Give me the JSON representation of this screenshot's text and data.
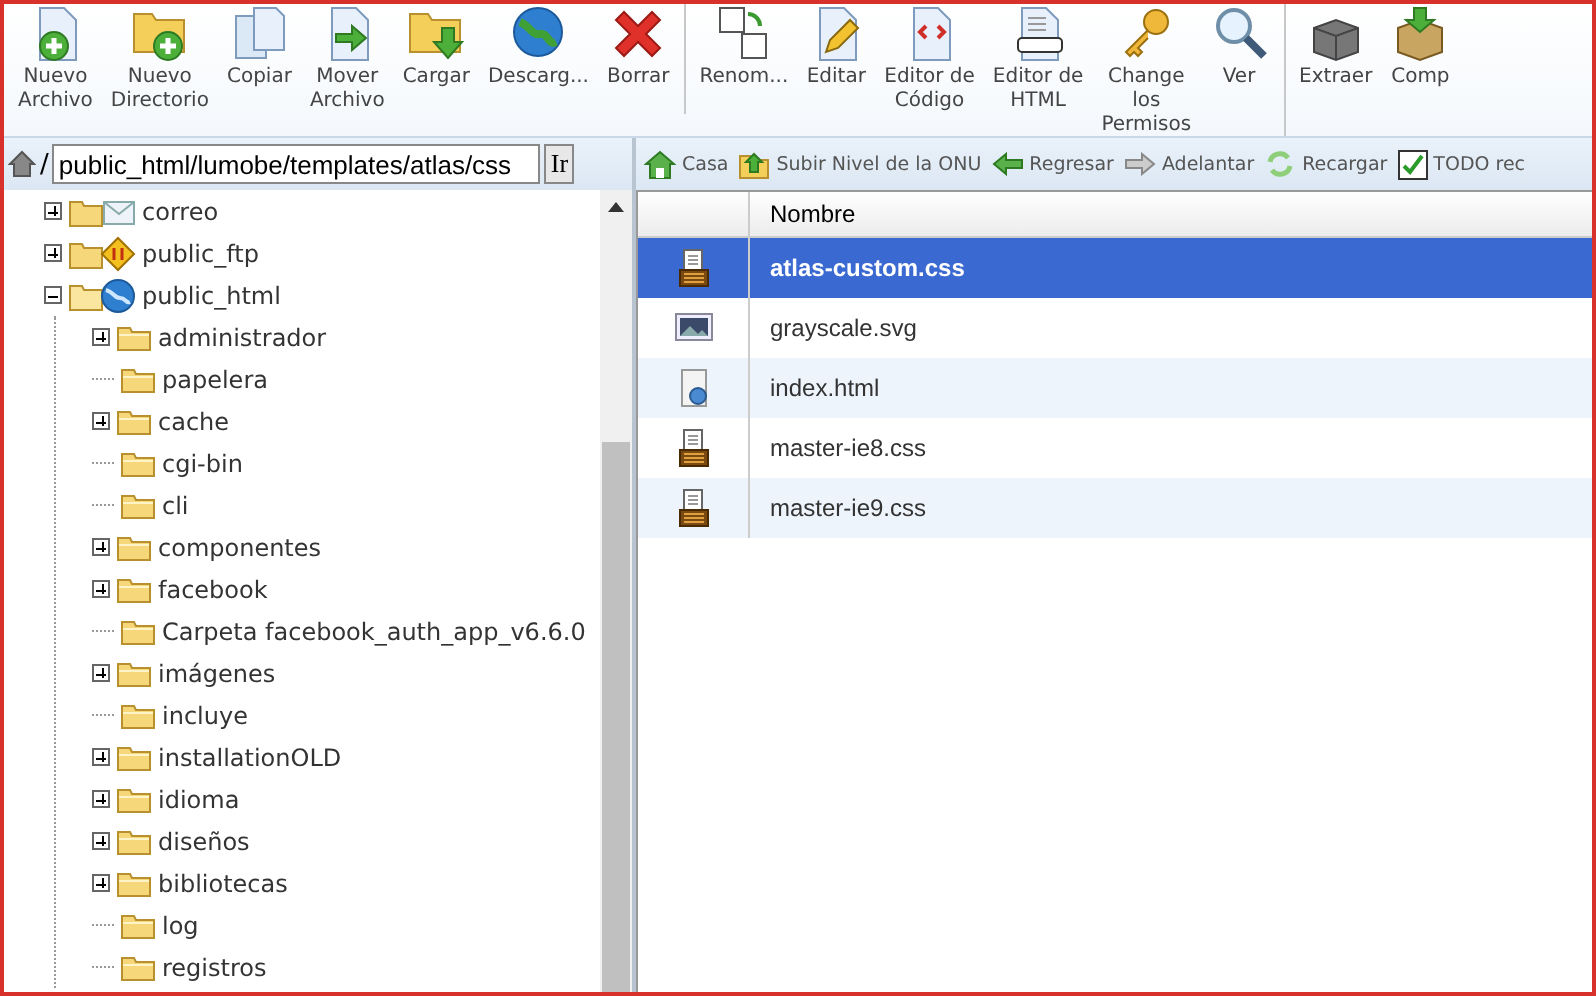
{
  "toolbar": {
    "groups": [
      {
        "buttons": [
          {
            "kind": "new-file",
            "label": "Nuevo\nArchivo"
          },
          {
            "kind": "new-folder",
            "label": "Nuevo\nDirectorio"
          },
          {
            "kind": "copy",
            "label": "Copiar"
          },
          {
            "kind": "move",
            "label": "Mover\nArchivo"
          },
          {
            "kind": "upload",
            "label": "Cargar"
          },
          {
            "kind": "download",
            "label": "Descarg..."
          },
          {
            "kind": "delete",
            "label": "Borrar"
          }
        ]
      },
      {
        "buttons": [
          {
            "kind": "rename",
            "label": "Renom..."
          },
          {
            "kind": "edit",
            "label": "Editar"
          },
          {
            "kind": "code",
            "label": "Editor de\nCódigo"
          },
          {
            "kind": "html",
            "label": "Editor de\nHTML"
          },
          {
            "kind": "key",
            "label": "Change\nlos\nPermisos"
          },
          {
            "kind": "view",
            "label": "Ver"
          }
        ]
      },
      {
        "buttons": [
          {
            "kind": "extract",
            "label": "Extraer"
          },
          {
            "kind": "compress",
            "label": "Comp"
          }
        ]
      }
    ]
  },
  "path_bar": {
    "separator": "/",
    "value": "public_html/lumobe/templates/atlas/css",
    "go_button": "Ir"
  },
  "tree": [
    {
      "label": "correo",
      "kind": "mail",
      "has_children": true,
      "expanded": false
    },
    {
      "label": "public_ftp",
      "kind": "ftp",
      "has_children": true,
      "expanded": false
    },
    {
      "label": "public_html",
      "kind": "web",
      "has_children": true,
      "expanded": true,
      "children": [
        {
          "label": "administrador",
          "kind": "folder",
          "has_children": true,
          "expanded": false
        },
        {
          "label": "papelera",
          "kind": "folder",
          "has_children": false,
          "expanded": false
        },
        {
          "label": "cache",
          "kind": "folder",
          "has_children": true,
          "expanded": false
        },
        {
          "label": "cgi-bin",
          "kind": "folder",
          "has_children": false,
          "expanded": false
        },
        {
          "label": "cli",
          "kind": "folder",
          "has_children": false,
          "expanded": false
        },
        {
          "label": "componentes",
          "kind": "folder",
          "has_children": true,
          "expanded": false
        },
        {
          "label": "facebook",
          "kind": "folder",
          "has_children": true,
          "expanded": false
        },
        {
          "label": "Carpeta facebook_auth_app_v6.6.0",
          "kind": "folder",
          "has_children": false,
          "expanded": false
        },
        {
          "label": "imágenes",
          "kind": "folder",
          "has_children": true,
          "expanded": false
        },
        {
          "label": "incluye",
          "kind": "folder",
          "has_children": false,
          "expanded": false
        },
        {
          "label": "installationOLD",
          "kind": "folder",
          "has_children": true,
          "expanded": false
        },
        {
          "label": "idioma",
          "kind": "folder",
          "has_children": true,
          "expanded": false
        },
        {
          "label": "diseños",
          "kind": "folder",
          "has_children": true,
          "expanded": false
        },
        {
          "label": "bibliotecas",
          "kind": "folder",
          "has_children": true,
          "expanded": false
        },
        {
          "label": "log",
          "kind": "folder",
          "has_children": false,
          "expanded": false
        },
        {
          "label": "registros",
          "kind": "folder",
          "has_children": false,
          "expanded": false
        }
      ]
    }
  ],
  "nav_bar": [
    {
      "kind": "home",
      "label": "Casa"
    },
    {
      "kind": "up",
      "label": "Subir Nivel de la ONU"
    },
    {
      "kind": "back",
      "label": "Regresar"
    },
    {
      "kind": "forward",
      "label": "Adelantar"
    },
    {
      "kind": "reload",
      "label": "Recargar"
    },
    {
      "kind": "select-all",
      "label": "TODO rec"
    }
  ],
  "table": {
    "columns": [
      "Nombre"
    ],
    "rows": [
      {
        "name": "atlas-custom.css",
        "kind": "css",
        "selected": true
      },
      {
        "name": "grayscale.svg",
        "kind": "image",
        "selected": false
      },
      {
        "name": "index.html",
        "kind": "html",
        "selected": false
      },
      {
        "name": "master-ie8.css",
        "kind": "css",
        "selected": false
      },
      {
        "name": "master-ie9.css",
        "kind": "css",
        "selected": false
      }
    ]
  }
}
